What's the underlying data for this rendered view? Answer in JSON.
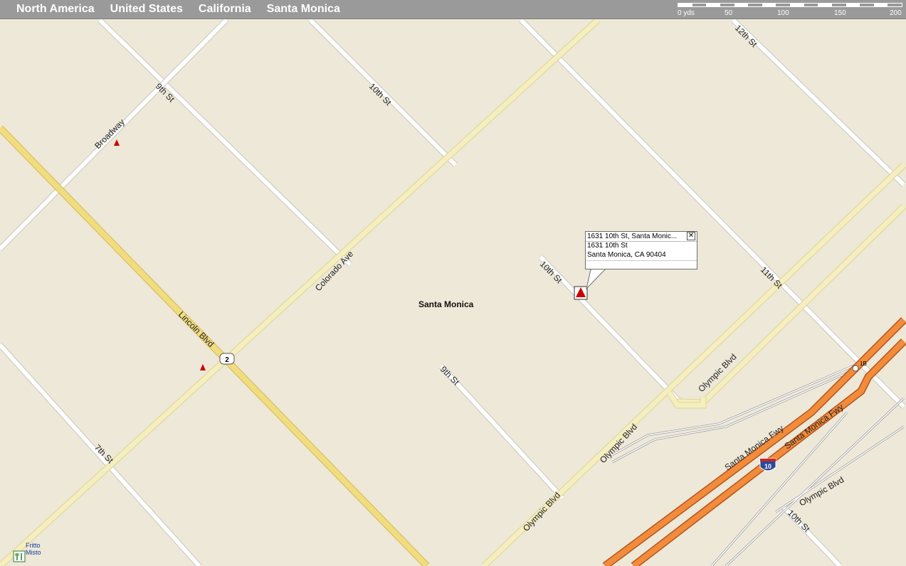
{
  "breadcrumb": [
    "North America",
    "United States",
    "California",
    "Santa Monica"
  ],
  "scale": {
    "ticks": [
      "0 yds",
      "50",
      "100",
      "150",
      "200"
    ]
  },
  "colors": {
    "land": "#ede8d8",
    "street": "#ffffff",
    "street_casing": "#c9c6bd",
    "arterial": "#f4eec0",
    "arterial_casing": "#e2d58f",
    "highway": "#f0dd82",
    "highway_casing": "#d9b84a",
    "freeway": "#f08c3c",
    "freeway_casing": "#b8541a",
    "marker": "#cc0000"
  },
  "map": {
    "city_label": "Santa Monica",
    "road_labels": {
      "broadway": "Broadway",
      "ninth_st_top": "9th St",
      "tenth_st_top": "10th St",
      "twelfth_st": "12th St",
      "colorado_ave": "Colorado Ave",
      "lincoln_blvd": "Lincoln Blvd",
      "tenth_st_mid": "10th St",
      "eleventh_st": "11th St",
      "ninth_st_mid": "9th St",
      "seventh_st": "7th St",
      "olympic_blvd_bottom": "Olympic Blvd",
      "olympic_blvd_mid": "Olympic Blvd",
      "olympic_blvd_right": "Olympic Blvd",
      "olympic_blvd_lower_right": "Olympic Blvd",
      "santa_monica_fwy_1": "Santa Monica Fwy",
      "santa_monica_fwy_2": "Santa Monica Fwy",
      "tenth_st_bottom": "10th St"
    },
    "shields": {
      "state_route": "2",
      "interstate": "10",
      "exit": "1B"
    },
    "poi": {
      "restaurant": "Fritto Misto"
    }
  },
  "popup": {
    "title": "1631 10th St, Santa Monic...",
    "close": "✕",
    "line1": "1631 10th St",
    "line2": "Santa Monica, CA 90404"
  }
}
